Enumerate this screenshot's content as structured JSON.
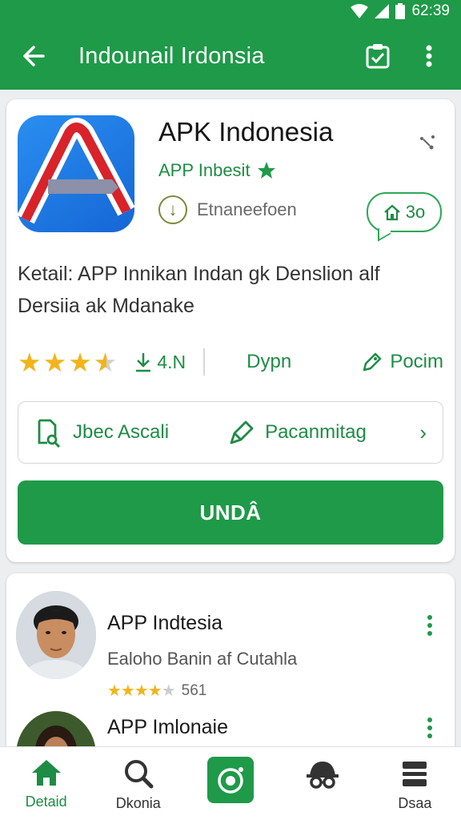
{
  "status": {
    "time": "62:39"
  },
  "appbar": {
    "title": "Indounail Irdonsia"
  },
  "app": {
    "name": "APK Indonesia",
    "developer": "APP Inbesit",
    "info_text": "Etnaneefoen",
    "comments_count": "3o",
    "description": "Ketail: APP Innikan Indan gk Denslion alf Dersiia ak Mdanake"
  },
  "rating": {
    "value": 3.5,
    "downloads": "4.N",
    "stat2": "Dypn",
    "stat3": "Pocim"
  },
  "actions": {
    "action1": "Jbec Ascali",
    "action2": "Pacanmitag"
  },
  "install_button": "UNDÂ",
  "list": [
    {
      "title": "APP Indtesia",
      "subtitle": "Ealoho Banin af Cutahla",
      "count": "561",
      "stars": 4
    },
    {
      "title": "APP Imlonaie",
      "subtitle": "",
      "count": "",
      "stars": 0
    }
  ],
  "nav": [
    {
      "label": "Detaid",
      "icon": "home-icon"
    },
    {
      "label": "Dkonia",
      "icon": "search-icon"
    },
    {
      "label": "",
      "icon": "camera-icon"
    },
    {
      "label": "",
      "icon": "incognito-icon"
    },
    {
      "label": "Dsaa",
      "icon": "list-icon"
    }
  ],
  "colors": {
    "primary": "#1e9a48",
    "accent_text": "#1e8c45",
    "star": "#f2b41b",
    "icon_blue": "#1566d6",
    "icon_red": "#d8232a"
  }
}
